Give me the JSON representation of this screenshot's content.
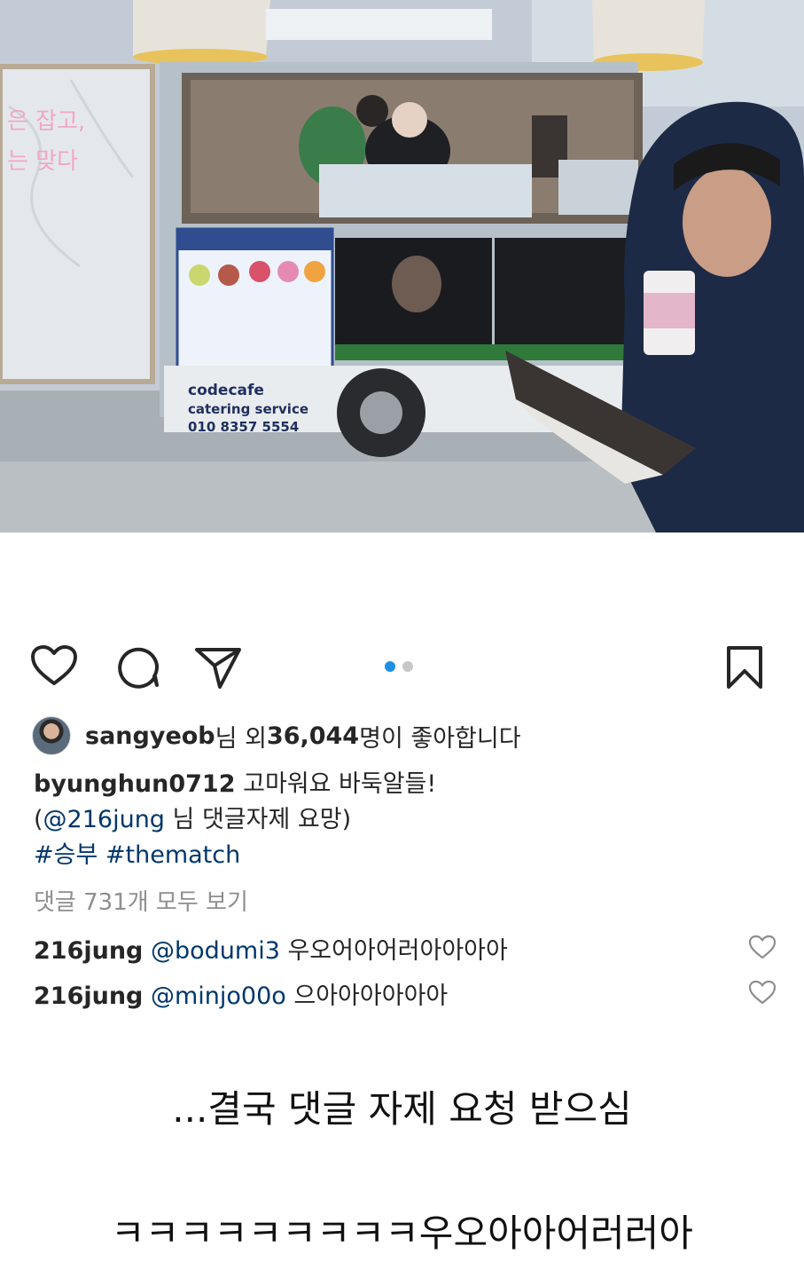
{
  "post": {
    "likes": {
      "user": "sangyeob",
      "prefix": "님 외 ",
      "count": "36,044",
      "suffix": "명이 좋아합니다"
    },
    "caption": {
      "author": "byunghun0712",
      "text1": " 고마워요 바둑알들!",
      "line2_open": "(",
      "mention": "@216jung",
      "line2_rest": " 님 댓글자제 요망)",
      "hashtag1": "#승부",
      "hashtag2": "#thematch"
    },
    "view_all_comments": "댓글 731개 모두 보기",
    "comments": [
      {
        "user": "216jung",
        "mention": "@bodumi3",
        "text": " 우오어아어러아아아아"
      },
      {
        "user": "216jung",
        "mention": "@minjo00o",
        "text": " 으아아아아아아"
      }
    ],
    "carousel": {
      "total": 2,
      "current": 1
    }
  },
  "photo_text": {
    "truck_brand": "codecafe",
    "truck_service": "catering service",
    "truck_phone": "010 8357 5554"
  },
  "overlay": {
    "line1": "...결국 댓글 자제 요청 받으심",
    "line2": "ㅋㅋㅋㅋㅋㅋㅋㅋㅋ우오아아어러러아"
  },
  "colors": {
    "link": "#00376b",
    "carousel_active": "#1f8fe6",
    "carousel_inactive": "#c7c7c7",
    "muted": "#8e8e8e"
  },
  "icons": [
    "heart-icon",
    "comment-icon",
    "share-icon",
    "bookmark-icon",
    "small-heart-icon"
  ]
}
